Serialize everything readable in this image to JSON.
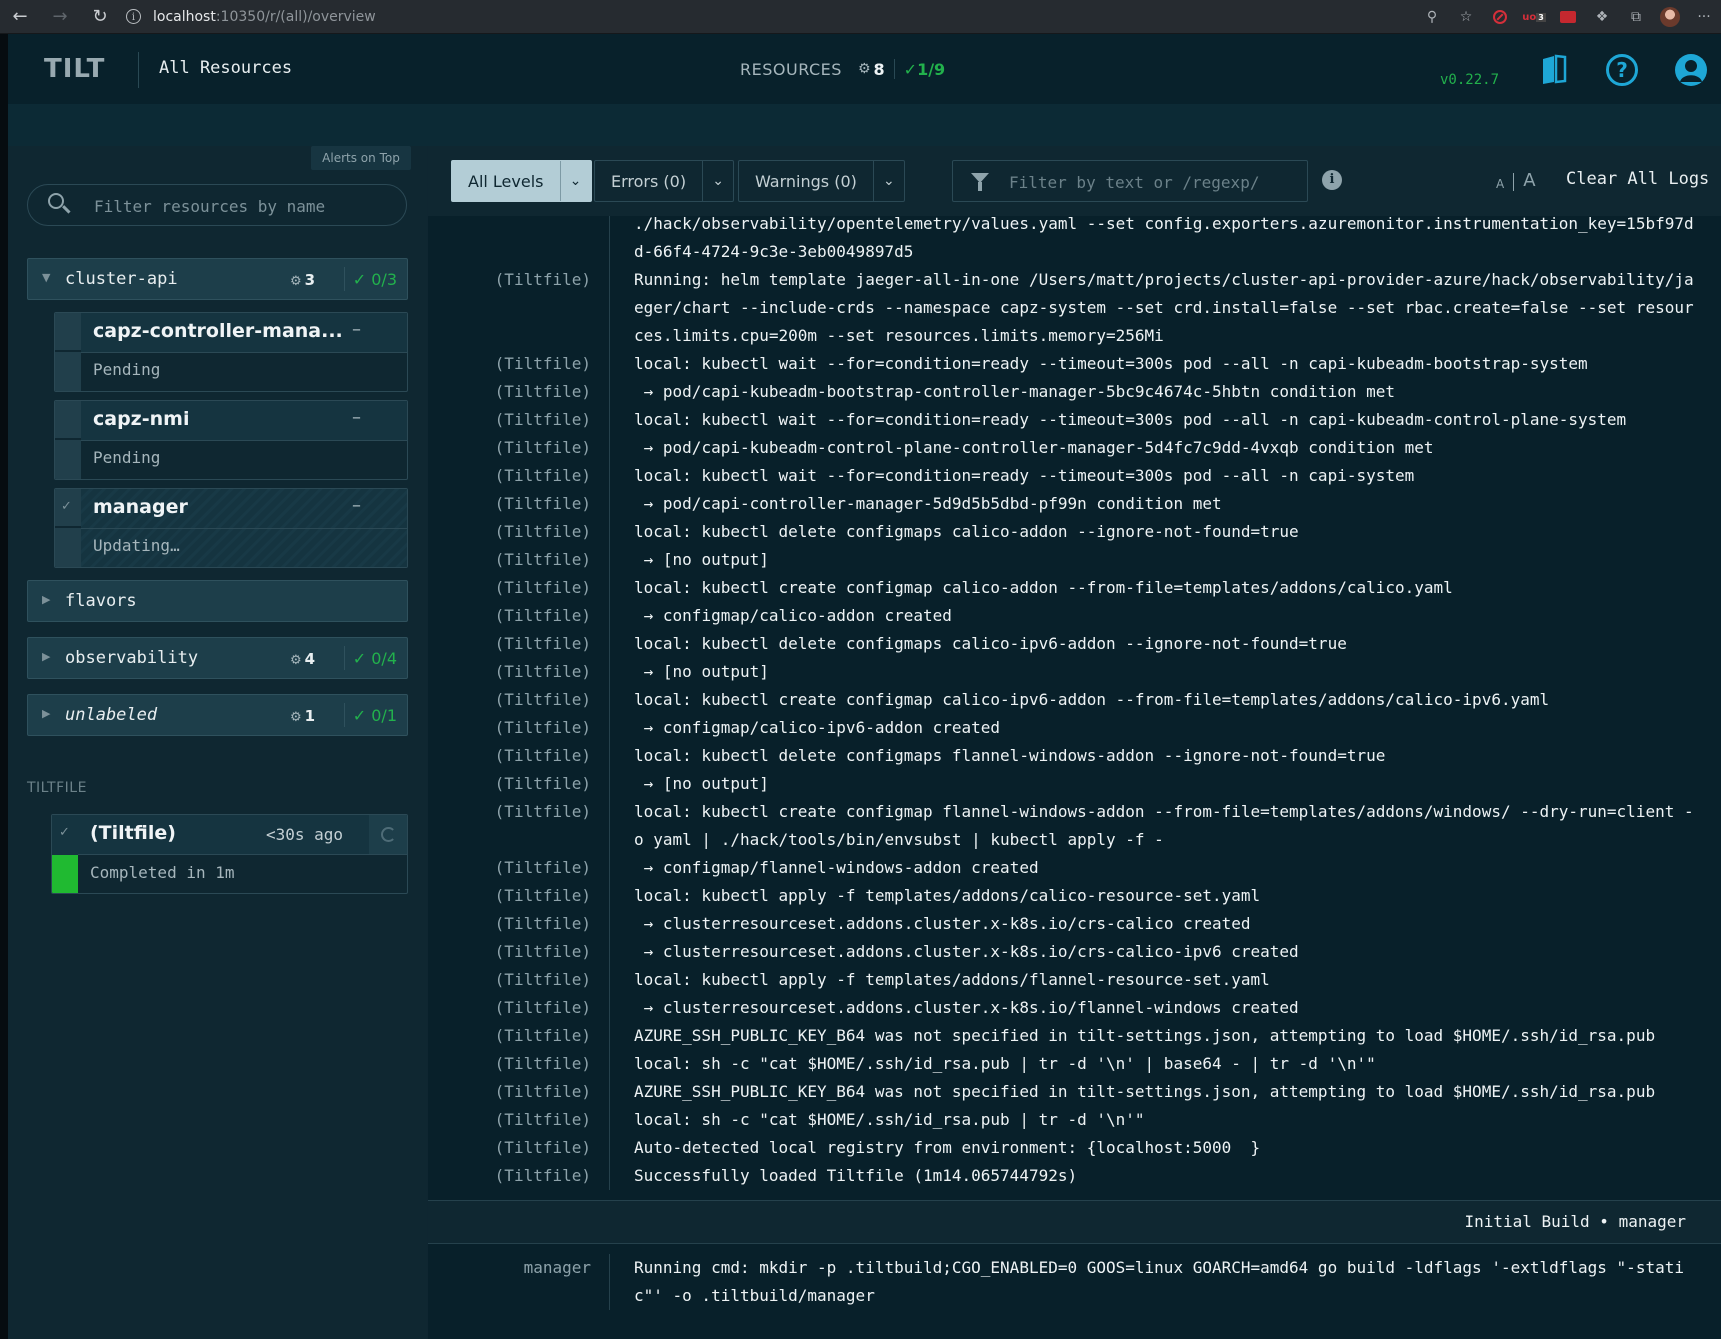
{
  "browser": {
    "url_host": "localhost",
    "url_path": ":10350/r/(all)/overview",
    "extension_badge": "3",
    "more_label": "···"
  },
  "header": {
    "logo": "TILT",
    "title": "All Resources",
    "resources_label": "RESOURCES",
    "resources_count": "8",
    "ok_count": "1/9",
    "version": "v0.22.7",
    "help_glyph": "?"
  },
  "sidebar": {
    "alerts_on_top": "Alerts on Top",
    "search_placeholder": "Filter resources by name",
    "groups": {
      "cluster_api": {
        "name": "cluster-api",
        "count": "3",
        "ok": "0/3"
      },
      "flavors": {
        "name": "flavors"
      },
      "observability": {
        "name": "observability",
        "count": "4",
        "ok": "0/4"
      },
      "unlabeled": {
        "name": "unlabeled",
        "count": "1",
        "ok": "0/1"
      }
    },
    "resources": [
      {
        "name": "capz-controller-mana...",
        "status": "Pending",
        "dash": "–"
      },
      {
        "name": "capz-nmi",
        "status": "Pending",
        "dash": "–"
      },
      {
        "name": "manager",
        "status": "Updating…",
        "dash": "–"
      }
    ],
    "tiltfile_label": "TILTFILE",
    "tiltfile": {
      "name": "(Tiltfile)",
      "ago": "<30s ago",
      "status": "Completed in 1m"
    }
  },
  "toolbar": {
    "all_levels": "All Levels",
    "errors": "Errors (0)",
    "warnings": "Warnings (0)",
    "filter_placeholder": "Filter by text or /regexp/",
    "font_small": "A",
    "font_big": "A",
    "clear_logs": "Clear All Logs"
  },
  "logs": [
    {
      "src": "",
      "msg": "./hack/observability/opentelemetry/values.yaml --set config.exporters.azuremonitor.instrumentation_key=15bf97dd-66f4-4724-9c3e-3eb0049897d5"
    },
    {
      "src": "(Tiltfile)",
      "msg": "Running: helm template jaeger-all-in-one /Users/matt/projects/cluster-api-provider-azure/hack/observability/jaeger/chart --include-crds --namespace capz-system --set crd.install=false --set rbac.create=false --set resources.limits.cpu=200m --set resources.limits.memory=256Mi"
    },
    {
      "src": "(Tiltfile)",
      "msg": "local: kubectl wait --for=condition=ready --timeout=300s pod --all -n capi-kubeadm-bootstrap-system"
    },
    {
      "src": "(Tiltfile)",
      "msg": " → pod/capi-kubeadm-bootstrap-controller-manager-5bc9c4674c-5hbtn condition met"
    },
    {
      "src": "(Tiltfile)",
      "msg": "local: kubectl wait --for=condition=ready --timeout=300s pod --all -n capi-kubeadm-control-plane-system"
    },
    {
      "src": "(Tiltfile)",
      "msg": " → pod/capi-kubeadm-control-plane-controller-manager-5d4fc7c9dd-4vxqb condition met"
    },
    {
      "src": "(Tiltfile)",
      "msg": "local: kubectl wait --for=condition=ready --timeout=300s pod --all -n capi-system"
    },
    {
      "src": "(Tiltfile)",
      "msg": " → pod/capi-controller-manager-5d9d5b5dbd-pf99n condition met"
    },
    {
      "src": "(Tiltfile)",
      "msg": "local: kubectl delete configmaps calico-addon --ignore-not-found=true"
    },
    {
      "src": "(Tiltfile)",
      "msg": " → [no output]"
    },
    {
      "src": "(Tiltfile)",
      "msg": "local: kubectl create configmap calico-addon --from-file=templates/addons/calico.yaml"
    },
    {
      "src": "(Tiltfile)",
      "msg": " → configmap/calico-addon created"
    },
    {
      "src": "(Tiltfile)",
      "msg": "local: kubectl delete configmaps calico-ipv6-addon --ignore-not-found=true"
    },
    {
      "src": "(Tiltfile)",
      "msg": " → [no output]"
    },
    {
      "src": "(Tiltfile)",
      "msg": "local: kubectl create configmap calico-ipv6-addon --from-file=templates/addons/calico-ipv6.yaml"
    },
    {
      "src": "(Tiltfile)",
      "msg": " → configmap/calico-ipv6-addon created"
    },
    {
      "src": "(Tiltfile)",
      "msg": "local: kubectl delete configmaps flannel-windows-addon --ignore-not-found=true"
    },
    {
      "src": "(Tiltfile)",
      "msg": " → [no output]"
    },
    {
      "src": "(Tiltfile)",
      "msg": "local: kubectl create configmap flannel-windows-addon --from-file=templates/addons/windows/ --dry-run=client -o yaml | ./hack/tools/bin/envsubst | kubectl apply -f -"
    },
    {
      "src": "(Tiltfile)",
      "msg": " → configmap/flannel-windows-addon created"
    },
    {
      "src": "(Tiltfile)",
      "msg": "local: kubectl apply -f templates/addons/calico-resource-set.yaml"
    },
    {
      "src": "(Tiltfile)",
      "msg": " → clusterresourceset.addons.cluster.x-k8s.io/crs-calico created"
    },
    {
      "src": "(Tiltfile)",
      "msg": " → clusterresourceset.addons.cluster.x-k8s.io/crs-calico-ipv6 created"
    },
    {
      "src": "(Tiltfile)",
      "msg": "local: kubectl apply -f templates/addons/flannel-resource-set.yaml"
    },
    {
      "src": "(Tiltfile)",
      "msg": " → clusterresourceset.addons.cluster.x-k8s.io/flannel-windows created"
    },
    {
      "src": "(Tiltfile)",
      "msg": "AZURE_SSH_PUBLIC_KEY_B64 was not specified in tilt-settings.json, attempting to load $HOME/.ssh/id_rsa.pub"
    },
    {
      "src": "(Tiltfile)",
      "msg": "local: sh -c \"cat $HOME/.ssh/id_rsa.pub | tr -d '\\n' | base64 - | tr -d '\\n'\""
    },
    {
      "src": "(Tiltfile)",
      "msg": "AZURE_SSH_PUBLIC_KEY_B64 was not specified in tilt-settings.json, attempting to load $HOME/.ssh/id_rsa.pub"
    },
    {
      "src": "(Tiltfile)",
      "msg": "local: sh -c \"cat $HOME/.ssh/id_rsa.pub | tr -d '\\n'\""
    },
    {
      "src": "(Tiltfile)",
      "msg": "Auto-detected local registry from environment: {localhost:5000  }"
    },
    {
      "src": "(Tiltfile)",
      "msg": "Successfully loaded Tiltfile (1m14.065744792s)"
    }
  ],
  "section_header": "Initial Build • manager",
  "logs_after": [
    {
      "src": "manager",
      "msg": "Running cmd: mkdir -p .tiltbuild;CGO_ENABLED=0 GOOS=linux GOARCH=amd64 go build -ldflags '-extldflags \"-static\"' -o .tiltbuild/manager"
    }
  ]
}
